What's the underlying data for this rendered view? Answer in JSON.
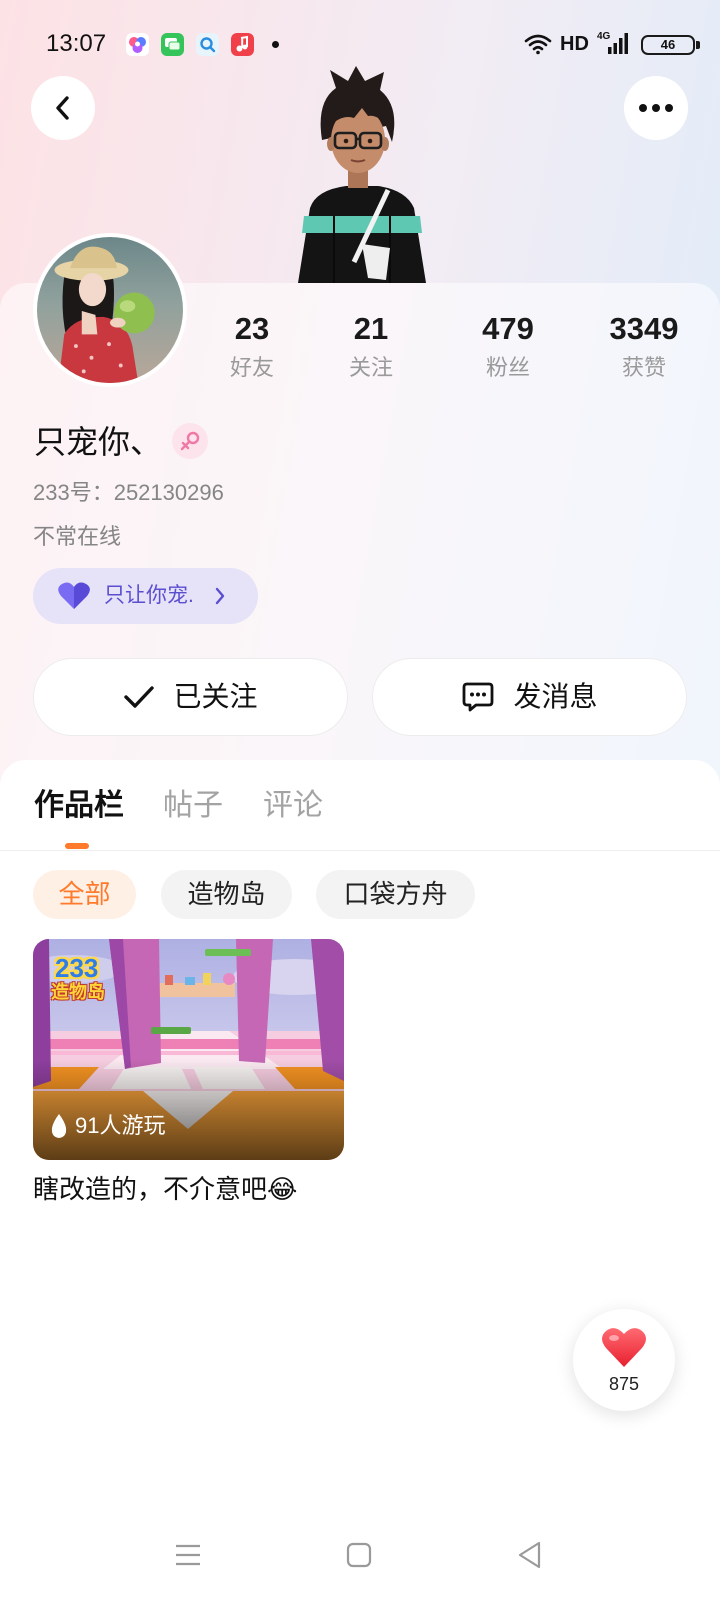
{
  "status_bar": {
    "time": "13:07",
    "hd": "HD",
    "network": "4G",
    "battery": "46",
    "notification_icons": [
      "game-center-app-icon",
      "messages-app-icon",
      "search-app-icon",
      "music-app-icon"
    ]
  },
  "header": {
    "back_icon": "chevron-left-icon",
    "more_icon": "more-horizontal-icon"
  },
  "profile": {
    "stats": [
      {
        "value": "23",
        "label": "好友"
      },
      {
        "value": "21",
        "label": "关注"
      },
      {
        "value": "479",
        "label": "粉丝"
      },
      {
        "value": "3349",
        "label": "获赞"
      }
    ],
    "name": "只宠你、",
    "gender_icon": "female-icon",
    "id_text": "233号：252130296",
    "online_status": "不常在线",
    "relation_tag": {
      "icon": "heart-icon",
      "text": "只让你宠."
    }
  },
  "actions": {
    "follow": {
      "icon": "check-icon",
      "label": "已关注"
    },
    "message": {
      "icon": "chat-bubble-icon",
      "label": "发消息"
    }
  },
  "tabs": {
    "items": [
      {
        "label": "作品栏",
        "active": true
      },
      {
        "label": "帖子",
        "active": false
      },
      {
        "label": "评论",
        "active": false
      }
    ]
  },
  "filters": {
    "items": [
      {
        "label": "全部",
        "active": true
      },
      {
        "label": "造物岛",
        "active": false
      },
      {
        "label": "口袋方舟",
        "active": false
      }
    ]
  },
  "works": [
    {
      "logo_number": "233",
      "logo_name": "造物岛",
      "plays_icon": "flame-icon",
      "plays": "91人游玩",
      "caption": "瞎改造的，不介意吧😂"
    }
  ],
  "like_button": {
    "icon": "heart-icon",
    "count": "875"
  },
  "system_nav": {
    "items": [
      "menu-icon",
      "home-square-icon",
      "back-triangle-icon"
    ]
  },
  "colors": {
    "accent": "#ff7a2a",
    "accent_bg": "#fff0e6",
    "tag_purple": "#5b4fd0",
    "tag_bg": "#e6e2f8",
    "female_pink": "#ef79a6",
    "like_red": "#f2374a"
  }
}
